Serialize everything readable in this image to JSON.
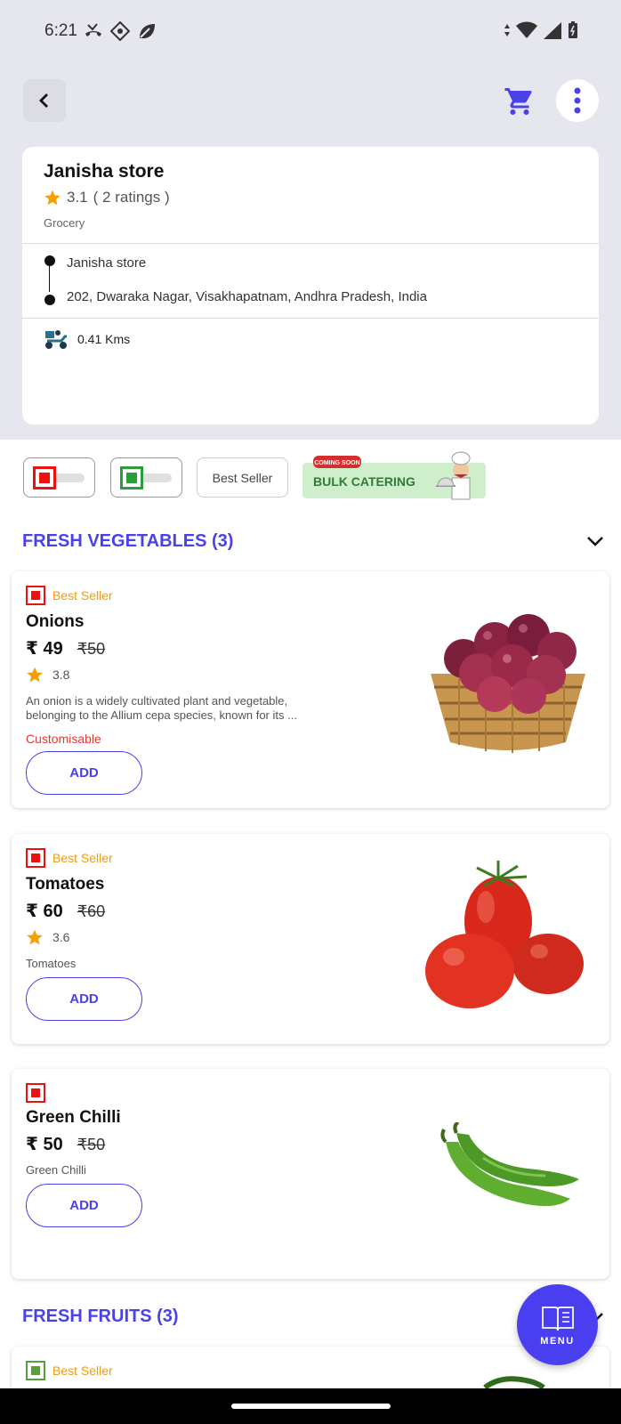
{
  "status_bar": {
    "time": "6:21",
    "left_icons": [
      "missed-call-icon",
      "vpn-key-icon",
      "leaf-icon"
    ],
    "right_icons": [
      "data-arrows-icon",
      "wifi-icon",
      "signal-icon",
      "battery-icon"
    ]
  },
  "header": {
    "back_icon": "chevron-left-icon",
    "cart_icon": "cart-icon",
    "more_icon": "more-vertical-icon",
    "accent_color": "#4a42e8"
  },
  "store": {
    "name": "Janisha store",
    "rating": "3.1",
    "ratings_count": "( 2 ratings )",
    "category": "Grocery",
    "route_from": "Janisha store",
    "route_to": "202, Dwaraka Nagar, Visakhapatnam, Andhra Pradesh, India",
    "distance": "0.41 Kms"
  },
  "filters": {
    "veg_toggle": "non-veg-toggle",
    "nonveg_toggle": "veg-toggle",
    "best_seller": "Best Seller",
    "bulk_catering_badge": "COMING SOON",
    "bulk_catering": "BULK CATERING"
  },
  "sections": [
    {
      "title": "FRESH VEGETABLES (3)",
      "items": [
        {
          "badge": "Best Seller",
          "name": "Onions",
          "price": "₹ 49",
          "mrp": "₹50",
          "rating": "3.8",
          "description": "An onion is a widely cultivated plant and vegetable, belonging to the Allium cepa species, known for its ...",
          "customisable": "Customisable",
          "add_label": "ADD"
        },
        {
          "badge": "Best Seller",
          "name": "Tomatoes",
          "price": "₹ 60",
          "mrp": "₹60",
          "rating": "3.6",
          "description": "Tomatoes",
          "add_label": "ADD"
        },
        {
          "name": "Green Chilli",
          "price": "₹ 50",
          "mrp": "₹50",
          "description": "Green Chilli",
          "add_label": "ADD"
        }
      ]
    },
    {
      "title": "FRESH FRUITS (3)",
      "items": [
        {
          "badge": "Best Seller"
        }
      ]
    }
  ],
  "fab": {
    "label": "MENU",
    "icon": "book-icon"
  }
}
